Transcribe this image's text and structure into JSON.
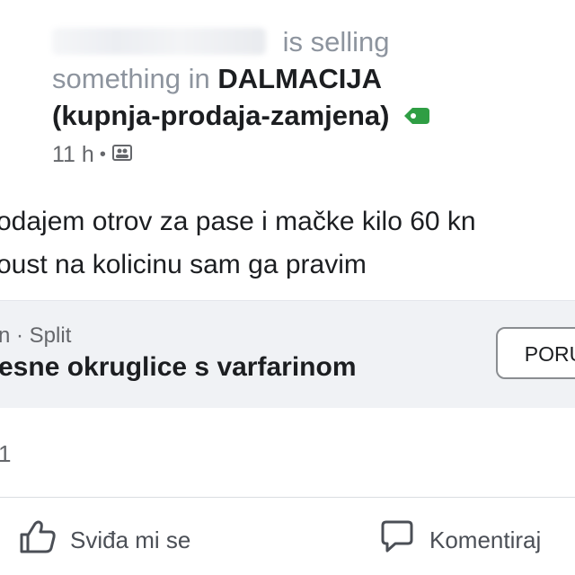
{
  "header": {
    "selling_text": "is selling",
    "something_in": "something in",
    "group_name": "DALMACIJA",
    "group_subtitle": "(kupnja-prodaja-zamjena)",
    "tag_icon": "green-tag-icon",
    "time": "11 h",
    "separator": "•",
    "privacy_icon": "group-audience-icon"
  },
  "post": {
    "line1": "odajem otrov za pase i mačke kilo 60 kn",
    "line2": "oust na kolicinu sam ga pravim"
  },
  "listing": {
    "price_location": "n · Split",
    "title": "esne okruglice s varfarinom",
    "message_button": "PORU"
  },
  "reactions": {
    "count": "1"
  },
  "actions": {
    "like_label": "Sviđa mi se",
    "comment_label": "Komentiraj"
  },
  "colors": {
    "tag_green": "#2f9e44",
    "muted_text": "#8d949e",
    "listing_bg": "#f0f2f5"
  }
}
